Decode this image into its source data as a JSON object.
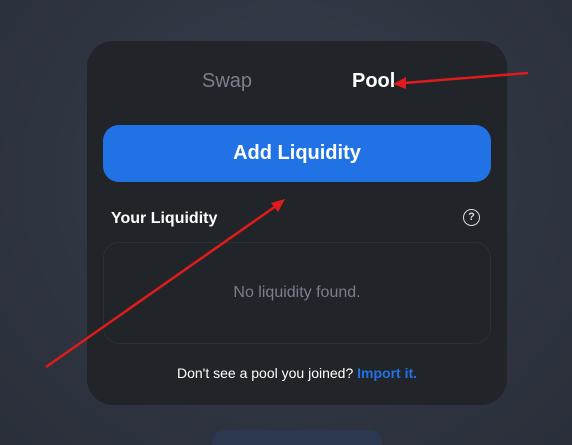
{
  "tabs": {
    "swap_label": "Swap",
    "pool_label": "Pool"
  },
  "actions": {
    "add_liquidity_label": "Add Liquidity"
  },
  "liquidity": {
    "heading": "Your Liquidity",
    "help_glyph": "?",
    "empty_message": "No liquidity found."
  },
  "footer": {
    "prompt": "Don't see a pool you joined?",
    "import_label": "Import it."
  },
  "colors": {
    "background": "#2f3541",
    "card": "#212429",
    "accent": "#2172e5",
    "muted_text": "#7a7f8a",
    "annotation_arrow": "#e01b1b"
  }
}
